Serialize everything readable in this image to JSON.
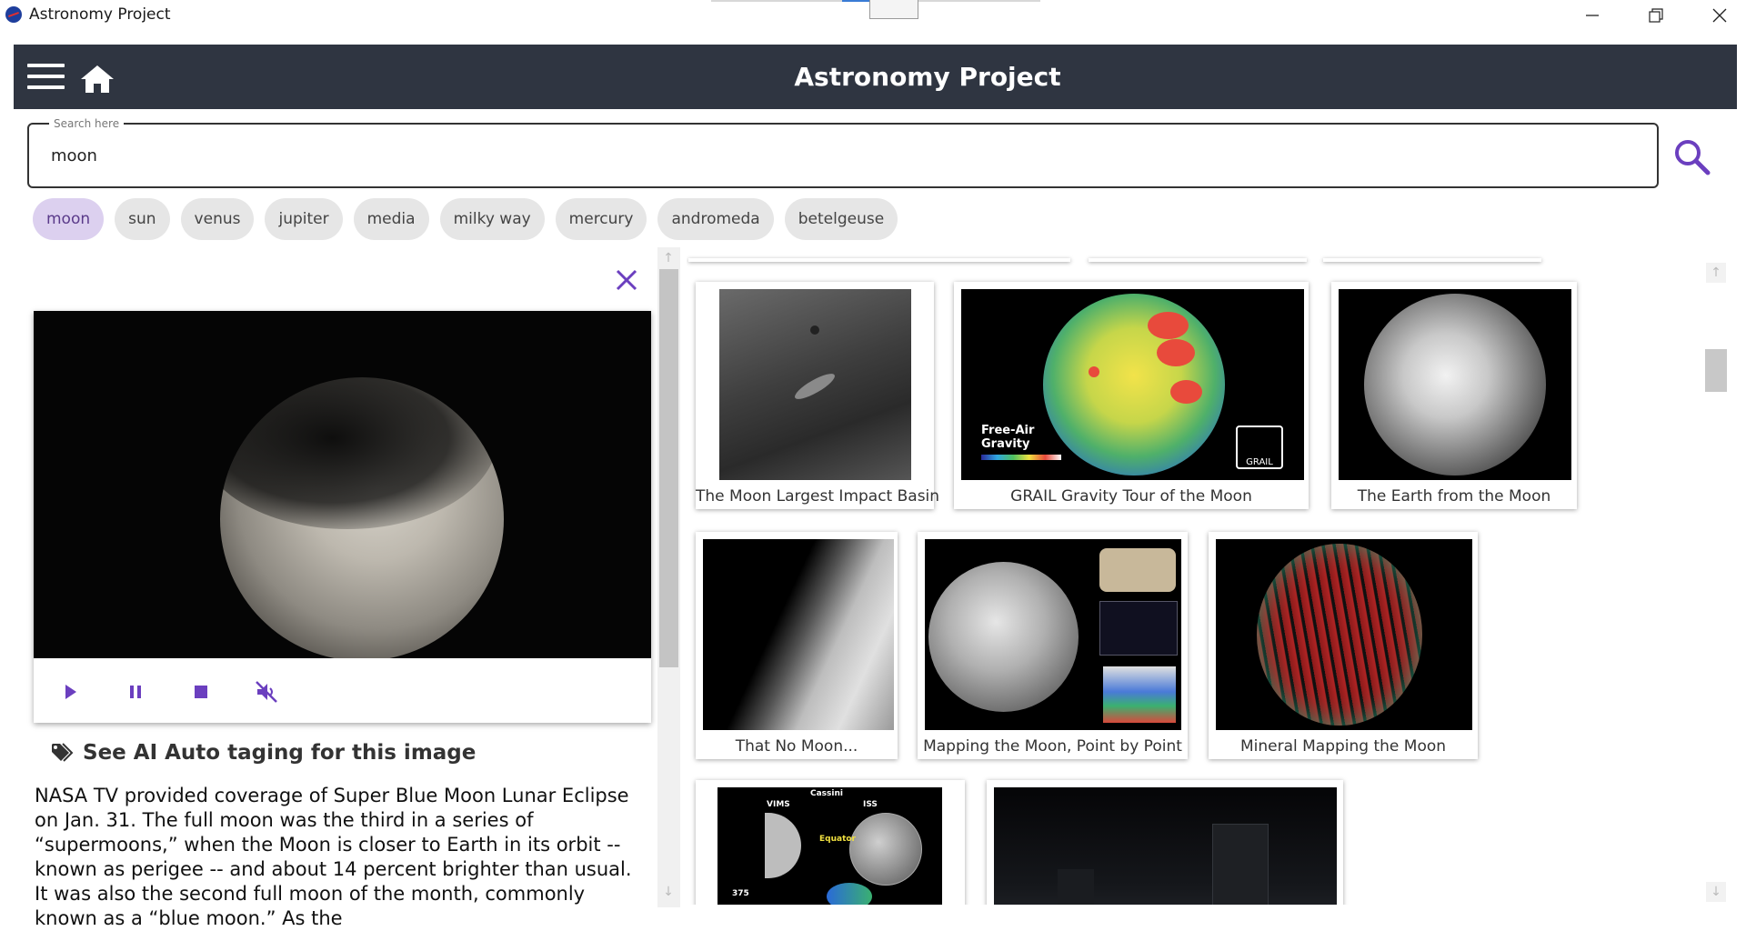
{
  "window": {
    "title": "Astronomy Project"
  },
  "header": {
    "title": "Astronomy Project"
  },
  "search": {
    "legend": "Search here",
    "value": "moon"
  },
  "chips": [
    "moon",
    "sun",
    "venus",
    "jupiter",
    "media",
    "milky way",
    "mercury",
    "andromeda",
    "betelgeuse"
  ],
  "active_chip": "moon",
  "detail": {
    "ai_tag_label": "See AI Auto taging for this image",
    "description": "NASA TV provided coverage of Super Blue Moon Lunar Eclipse on Jan. 31. The full moon was the third in a series of “supermoons,” when the Moon is closer to Earth in its orbit -- known as perigee -- and about 14 percent brighter than usual. It was also the second full moon of the month, commonly known as a “blue moon.” As the"
  },
  "gallery": [
    {
      "caption": "The Moon Largest Impact Basin"
    },
    {
      "caption": "GRAIL Gravity Tour of the Moon",
      "overlay": "Free-Air\nGravity",
      "badge": "GRAIL"
    },
    {
      "caption": "The Earth from the Moon"
    },
    {
      "caption": "That No Moon..."
    },
    {
      "caption": "Mapping the Moon, Point by Point"
    },
    {
      "caption": "Mineral Mapping the Moon"
    },
    {
      "caption": "",
      "labels": [
        "Cassini",
        "VIMS",
        "ISS",
        "Equator",
        "375"
      ]
    },
    {
      "caption": ""
    }
  ],
  "colors": {
    "header_bg": "#2f3541",
    "accent": "#6b3fbf",
    "chip_active_bg": "#dcd0ef",
    "chip_bg": "#e6e6e6"
  },
  "icons": [
    "menu-icon",
    "home-icon",
    "search-icon",
    "close-icon",
    "play-icon",
    "pause-icon",
    "stop-icon",
    "mute-icon",
    "tag-icon"
  ]
}
